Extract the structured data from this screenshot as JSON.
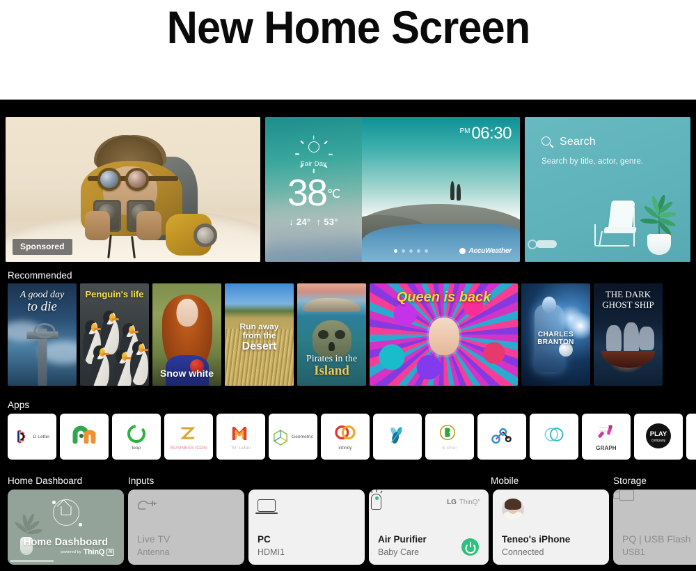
{
  "page": {
    "title": "New Home Screen"
  },
  "hero": {
    "sponsored": {
      "badge": "Sponsored",
      "name": "sponsored-banner"
    },
    "weather": {
      "condition": "Fair Day",
      "temperature": "38",
      "unit": "℃",
      "low": "↓ 24°",
      "high": "↑ 53°",
      "ampm": "PM",
      "time": "06:30",
      "provider": "AccuWeather",
      "dots": 5,
      "active_dot": 0
    },
    "search": {
      "title": "Search",
      "subtitle": "Search by title, actor, genre."
    }
  },
  "sections": {
    "recommended": "Recommended",
    "apps": "Apps",
    "home_dashboard": "Home Dashboard",
    "inputs": "Inputs",
    "mobile": "Mobile",
    "storage": "Storage"
  },
  "recommended": [
    {
      "id": "rec-1",
      "lines": [
        "A good day",
        "to die"
      ],
      "position": "top"
    },
    {
      "id": "rec-2",
      "lines": [
        "Penguin's life"
      ],
      "position": "top"
    },
    {
      "id": "rec-3",
      "lines": [
        "Snow white"
      ],
      "position": "bottom"
    },
    {
      "id": "rec-4",
      "lines": [
        "Run away",
        "from the",
        "Desert"
      ],
      "position": "middle"
    },
    {
      "id": "rec-5",
      "lines": [
        "Pirates in the",
        "Island"
      ],
      "position": "bottom"
    },
    {
      "id": "rec-6",
      "lines": [
        "Queen is back"
      ],
      "position": "top"
    },
    {
      "id": "rec-7",
      "lines": [
        "CHARLES BRANTON"
      ],
      "position": "middle"
    },
    {
      "id": "rec-8",
      "lines": [
        "THE DARK",
        "GHOST SHIP"
      ],
      "position": "top"
    }
  ],
  "apps": [
    {
      "label": "D Letter",
      "icon": "d-letter-icon",
      "layout": "inline"
    },
    {
      "label": "",
      "icon": "m-letter-icon",
      "layout": "stack"
    },
    {
      "label": "loop",
      "icon": "loop-icon",
      "layout": "stack"
    },
    {
      "label": "BUSINESS ICON",
      "icon": "business-z-icon",
      "layout": "inline"
    },
    {
      "label": "\"M\" Letter",
      "icon": "m-monogram-icon",
      "layout": "stack"
    },
    {
      "label": "Geometric",
      "icon": "geometric-icon",
      "layout": "inline"
    },
    {
      "label": "infinity",
      "icon": "infinity-icon",
      "layout": "stack"
    },
    {
      "label": "",
      "icon": "leaf-burst-icon",
      "layout": "stack"
    },
    {
      "label": "B letter",
      "icon": "b-letter-icon",
      "layout": "stack"
    },
    {
      "label": "",
      "icon": "molecule-icon",
      "layout": "stack"
    },
    {
      "label": "",
      "icon": "twin-circle-icon",
      "layout": "stack"
    },
    {
      "label": "GRAPH",
      "icon": "graph-icon",
      "layout": "stack"
    },
    {
      "label": "",
      "icon": "play-company-icon",
      "layout": "stack"
    },
    {
      "label": "",
      "icon": "blank-icon",
      "layout": "stack"
    }
  ],
  "dashboard": [
    {
      "id": "dash-home",
      "title": "Home Dashboard",
      "sub": "",
      "icon": "home-dashboard-icon",
      "powered_pre": "powered by",
      "powered_brand": "ThinQ",
      "powered_ai": "AI"
    },
    {
      "id": "dash-livetv",
      "title": "Live TV",
      "sub": "Antenna",
      "icon": "antenna-icon"
    },
    {
      "id": "dash-pc",
      "title": "PC",
      "sub": "HDMI1",
      "icon": "laptop-icon"
    },
    {
      "id": "dash-air",
      "title": "Air Purifier",
      "sub": "Baby Care",
      "icon": "air-purifier-icon",
      "brand_lg": "LG",
      "brand_thinq": "ThinQ°"
    },
    {
      "id": "dash-phone",
      "title": "Teneo's iPhone",
      "sub": "Connected",
      "icon": "avatar-icon"
    },
    {
      "id": "dash-usb",
      "title": "PQ | USB Flash",
      "sub": "USB1",
      "icon": "usb-flash-icon"
    }
  ],
  "colors": {
    "screen_bg": "#000000",
    "search_card": "#63b5bd",
    "weather_teal": "#2a9c96",
    "home_dashboard": "#93a399",
    "card_light": "#f1f1f1",
    "card_gray": "#c3c3c3",
    "accent_green": "#2ec27e",
    "title_yellow": "#f3d73f"
  }
}
